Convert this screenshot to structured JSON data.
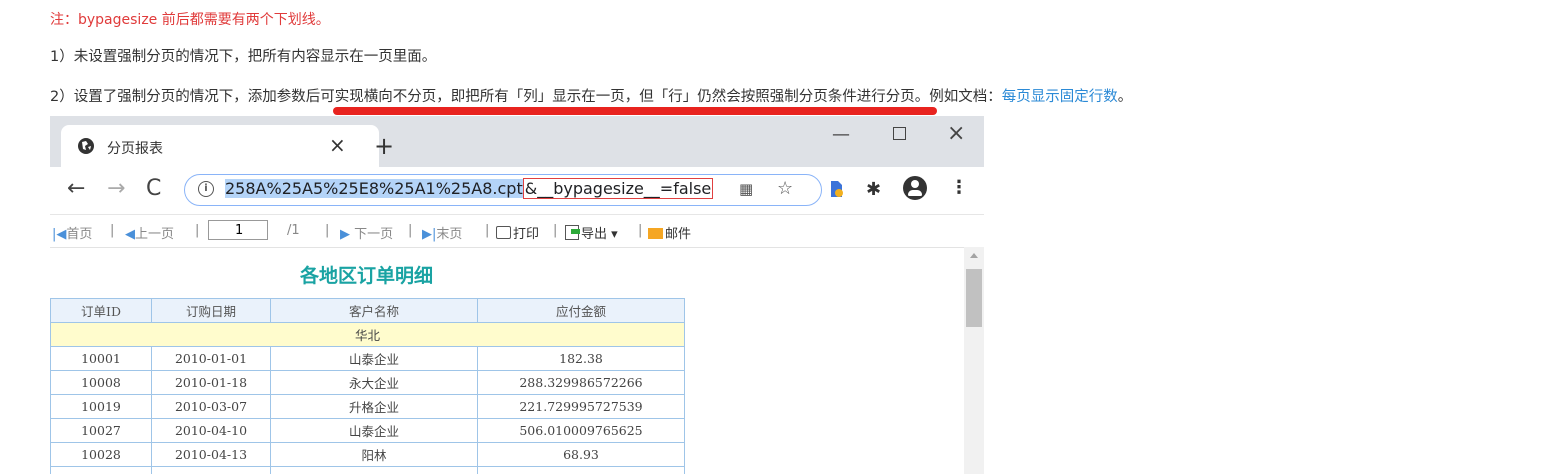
{
  "doc": {
    "note": "注：bypagesize 前后都需要有两个下划线。",
    "line1": "1）未设置强制分页的情况下，把所有内容显示在一页里面。",
    "line2_text": "2）设置了强制分页的情况下，添加参数后可实现横向不分页，即把所有「列」显示在一页，但「行」仍然会按照强制分页条件进行分页。例如文档：",
    "line2_link": "每页显示固定行数",
    "line2_end": "。"
  },
  "browser": {
    "tab_title": "分页报表",
    "tab_close": "×",
    "new_tab": "+",
    "url_base": "258A%25A5%25E8%25A1%25A8.cpt",
    "url_param": "&__bypagesize__=false"
  },
  "report_toolbar": {
    "first": "首页",
    "prev": "上一页",
    "page_input": "1",
    "total": "/1",
    "next": "下一页",
    "last": "末页",
    "print": "打印",
    "export": "导出",
    "mail": "邮件"
  },
  "report": {
    "title": "各地区订单明细",
    "columns": [
      "订单ID",
      "订购日期",
      "客户名称",
      "应付金额"
    ],
    "region": "华北",
    "rows": [
      [
        "10001",
        "2010-01-01",
        "山泰企业",
        "182.38"
      ],
      [
        "10008",
        "2010-01-18",
        "永大企业",
        "288.329986572266"
      ],
      [
        "10019",
        "2010-03-07",
        "升格企业",
        "221.729995727539"
      ],
      [
        "10027",
        "2010-04-10",
        "山泰企业",
        "506.010009765625"
      ],
      [
        "10028",
        "2010-04-13",
        "阳林",
        "68.93"
      ]
    ]
  }
}
